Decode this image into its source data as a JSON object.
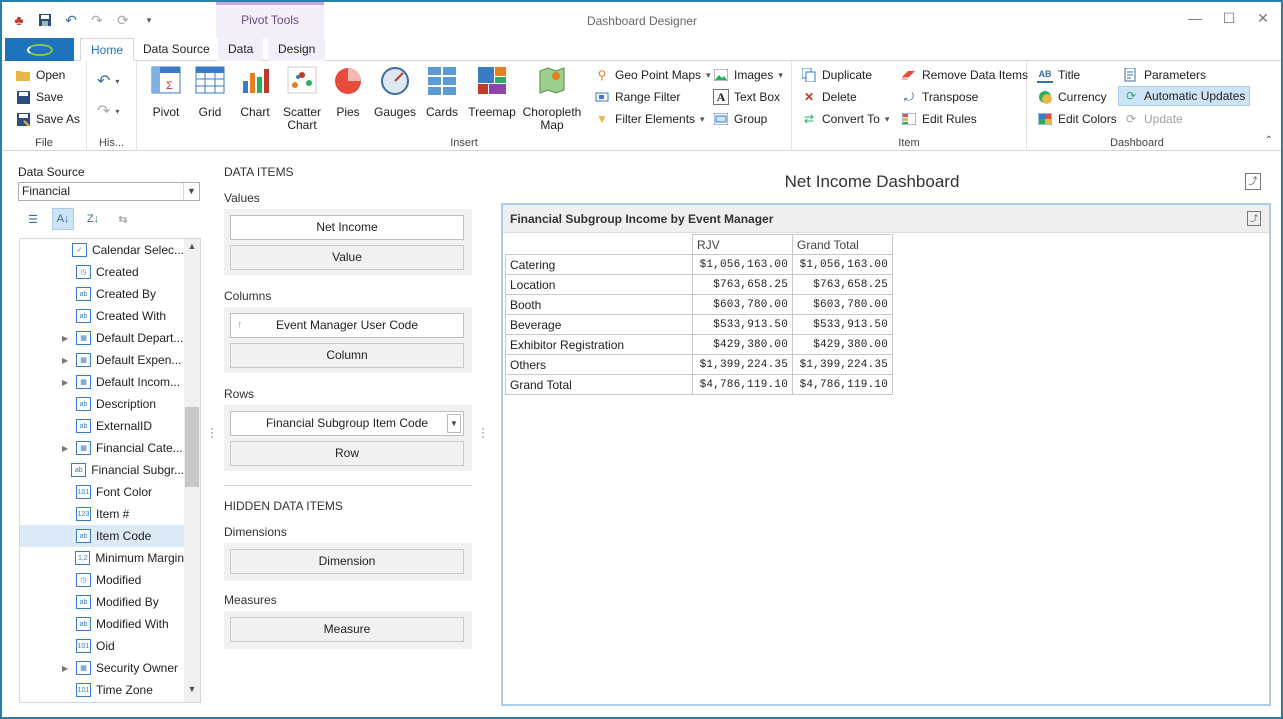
{
  "window": {
    "title": "Dashboard Designer",
    "context_tab_group": "Pivot Tools"
  },
  "tabs": {
    "home": "Home",
    "data_source": "Data Source",
    "data": "Data",
    "design": "Design"
  },
  "ribbon": {
    "file": {
      "label": "File",
      "open": "Open",
      "save": "Save",
      "save_as": "Save As"
    },
    "history": {
      "label": "His..."
    },
    "insert": {
      "label": "Insert",
      "pivot": "Pivot",
      "grid": "Grid",
      "chart": "Chart",
      "scatter_chart": "Scatter Chart",
      "pies": "Pies",
      "gauges": "Gauges",
      "cards": "Cards",
      "treemap": "Treemap",
      "choropleth_map": "Choropleth Map",
      "geo_point_maps": "Geo Point Maps",
      "range_filter": "Range Filter",
      "filter_elements": "Filter Elements",
      "images": "Images",
      "text_box": "Text Box",
      "group": "Group"
    },
    "item": {
      "label": "Item",
      "duplicate": "Duplicate",
      "delete": "Delete",
      "convert_to": "Convert To",
      "remove_data_items": "Remove Data Items",
      "transpose": "Transpose",
      "edit_rules": "Edit Rules"
    },
    "dashboard": {
      "label": "Dashboard",
      "title": "Title",
      "currency": "Currency",
      "edit_colors": "Edit Colors",
      "parameters": "Parameters",
      "automatic_updates": "Automatic Updates",
      "update": "Update"
    }
  },
  "data_source": {
    "label": "Data Source",
    "selected": "Financial",
    "fields": [
      {
        "name": "Calendar Selec...",
        "type": "check",
        "expandable": false
      },
      {
        "name": "Created",
        "type": "clock",
        "expandable": false
      },
      {
        "name": "Created By",
        "type": "ab",
        "expandable": false
      },
      {
        "name": "Created With",
        "type": "ab",
        "expandable": false
      },
      {
        "name": "Default Depart...",
        "type": "table",
        "expandable": true
      },
      {
        "name": "Default Expen...",
        "type": "table",
        "expandable": true
      },
      {
        "name": "Default Incom...",
        "type": "table",
        "expandable": true
      },
      {
        "name": "Description",
        "type": "ab",
        "expandable": false
      },
      {
        "name": "ExternalID",
        "type": "ab",
        "expandable": false
      },
      {
        "name": "Financial Cate...",
        "type": "table",
        "expandable": true
      },
      {
        "name": "Financial Subgr...",
        "type": "ab",
        "expandable": false
      },
      {
        "name": "Font Color",
        "type": "101",
        "expandable": false
      },
      {
        "name": "Item #",
        "type": "123",
        "expandable": false
      },
      {
        "name": "Item Code",
        "type": "ab",
        "expandable": false
      },
      {
        "name": "Minimum Margin",
        "type": "1.2",
        "expandable": false
      },
      {
        "name": "Modified",
        "type": "clock",
        "expandable": false
      },
      {
        "name": "Modified By",
        "type": "ab",
        "expandable": false
      },
      {
        "name": "Modified With",
        "type": "ab",
        "expandable": false
      },
      {
        "name": "Oid",
        "type": "101",
        "expandable": false
      },
      {
        "name": "Security Owner",
        "type": "table",
        "expandable": true
      },
      {
        "name": "Time Zone",
        "type": "101",
        "expandable": false
      }
    ]
  },
  "data_items": {
    "header": "DATA ITEMS",
    "values_label": "Values",
    "values_item": "Net Income",
    "values_placeholder": "Value",
    "columns_label": "Columns",
    "columns_item": "Event Manager User Code",
    "columns_placeholder": "Column",
    "rows_label": "Rows",
    "rows_item": "Financial Subgroup Item Code",
    "rows_placeholder": "Row",
    "hidden_header": "HIDDEN DATA ITEMS",
    "dimensions_label": "Dimensions",
    "dimensions_placeholder": "Dimension",
    "measures_label": "Measures",
    "measures_placeholder": "Measure"
  },
  "dashboard": {
    "title": "Net Income Dashboard",
    "pivot": {
      "caption": "Financial Subgroup Income by Event Manager",
      "columns": [
        "RJV",
        "Grand Total"
      ],
      "rows": [
        {
          "label": "Catering",
          "values": [
            "$1,056,163.00",
            "$1,056,163.00"
          ]
        },
        {
          "label": "Location",
          "values": [
            "$763,658.25",
            "$763,658.25"
          ]
        },
        {
          "label": "Booth",
          "values": [
            "$603,780.00",
            "$603,780.00"
          ]
        },
        {
          "label": "Beverage",
          "values": [
            "$533,913.50",
            "$533,913.50"
          ]
        },
        {
          "label": "Exhibitor Registration",
          "values": [
            "$429,380.00",
            "$429,380.00"
          ]
        },
        {
          "label": "Others",
          "values": [
            "$1,399,224.35",
            "$1,399,224.35"
          ]
        },
        {
          "label": "Grand Total",
          "values": [
            "$4,786,119.10",
            "$4,786,119.10"
          ]
        }
      ]
    }
  }
}
